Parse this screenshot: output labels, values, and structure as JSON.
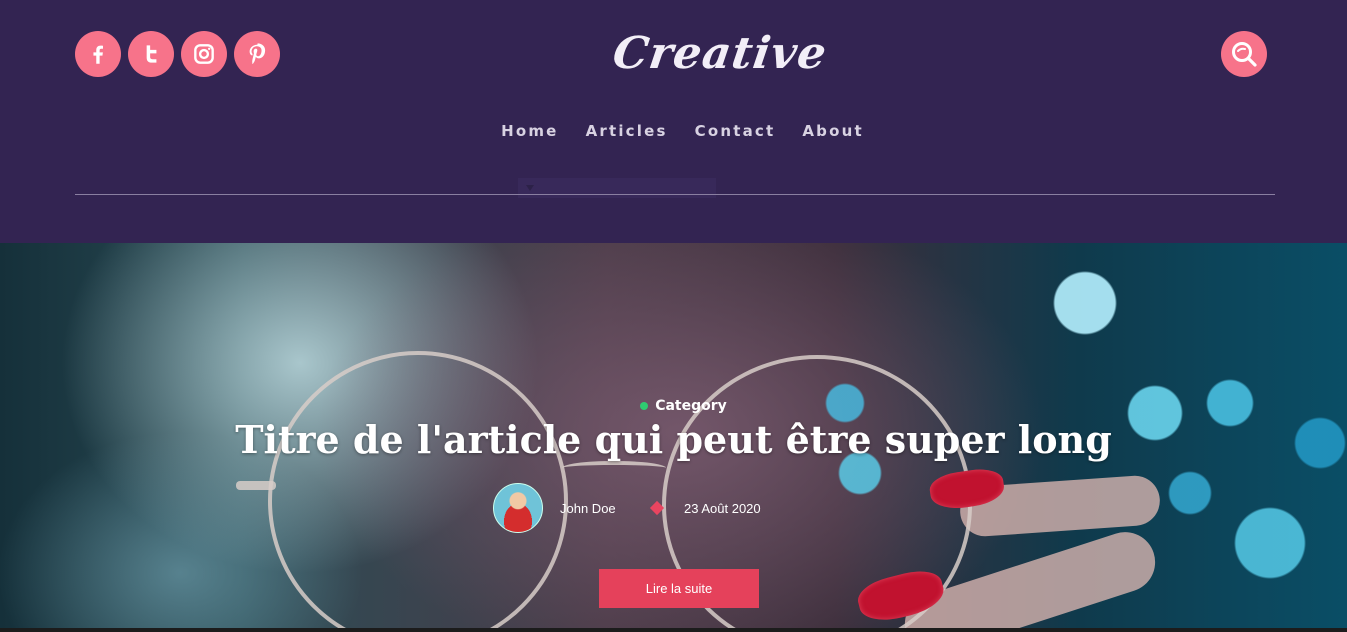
{
  "social": {
    "items": [
      {
        "name": "facebook",
        "icon": "facebook-icon"
      },
      {
        "name": "twitter",
        "icon": "twitter-icon"
      },
      {
        "name": "instagram",
        "icon": "instagram-icon"
      },
      {
        "name": "pinterest",
        "icon": "pinterest-icon"
      }
    ]
  },
  "logo": {
    "text": "Creative"
  },
  "search": {
    "icon": "search-icon"
  },
  "nav": {
    "items": [
      {
        "label": "Home"
      },
      {
        "label": "Articles"
      },
      {
        "label": "Contact"
      },
      {
        "label": "About"
      }
    ]
  },
  "hero": {
    "category": "Category",
    "title": "Titre de l'article qui peut être super long",
    "author": "John Doe",
    "date": "23 Août 2020",
    "cta_label": "Lire la suite"
  },
  "colors": {
    "header_bg": "#332452",
    "accent_pink": "#f7738a",
    "button_red": "#e5415b",
    "category_dot": "#2ecc71"
  }
}
